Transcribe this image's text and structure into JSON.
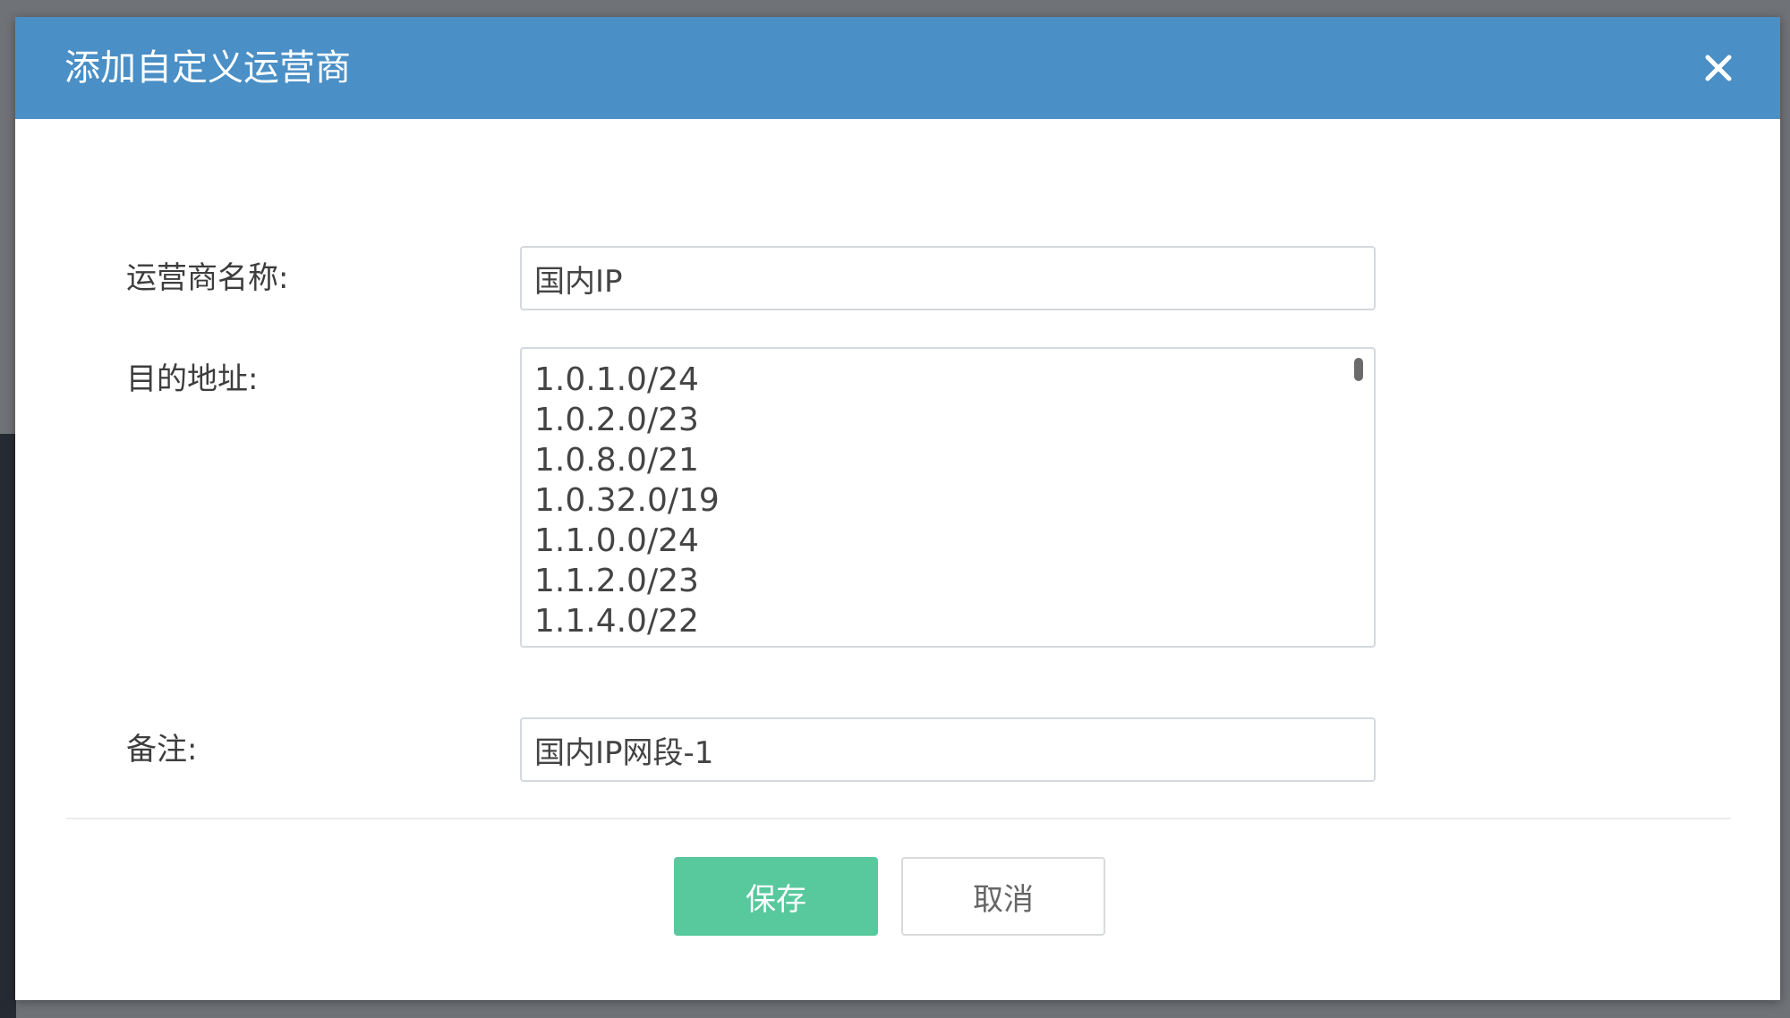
{
  "dialog": {
    "title": "添加自定义运营商",
    "close_icon": "close-icon"
  },
  "form": {
    "name": {
      "label": "运营商名称:",
      "value": "国内IP"
    },
    "destination": {
      "label": "目的地址:",
      "lines": [
        "1.0.1.0/24",
        "1.0.2.0/23",
        "1.0.8.0/21",
        "1.0.32.0/19",
        "1.1.0.0/24",
        "1.1.2.0/23",
        "1.1.4.0/22"
      ]
    },
    "remark": {
      "label": "备注:",
      "value": "国内IP网段-1"
    }
  },
  "buttons": {
    "save_label": "保存",
    "cancel_label": "取消"
  },
  "colors": {
    "header": "#4a8fc6",
    "save": "#58c89d"
  }
}
